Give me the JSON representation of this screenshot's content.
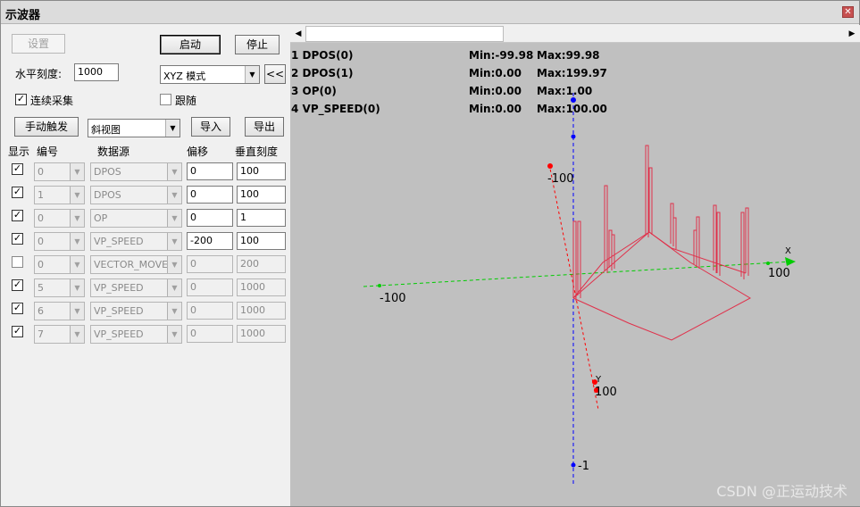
{
  "window": {
    "title": "示波器"
  },
  "controls": {
    "settings_label": "设置",
    "start_label": "启动",
    "stop_label": "停止",
    "hscale_label": "水平刻度:",
    "hscale_value": "1000",
    "mode_value": "XYZ 模式",
    "collapse_label": "<<",
    "continuous_label": "连续采集",
    "follow_label": "跟随",
    "manual_trigger_label": "手动触发",
    "view_value": "斜视图",
    "import_label": "导入",
    "export_label": "导出"
  },
  "channels": {
    "headers": [
      "显示",
      "编号",
      "数据源",
      "偏移",
      "垂直刻度"
    ],
    "rows": [
      {
        "show": true,
        "id": "0",
        "source": "DPOS",
        "offset": "0",
        "scale": "100",
        "enabled": true
      },
      {
        "show": true,
        "id": "1",
        "source": "DPOS",
        "offset": "0",
        "scale": "100",
        "enabled": true
      },
      {
        "show": true,
        "id": "0",
        "source": "OP",
        "offset": "0",
        "scale": "1",
        "enabled": true
      },
      {
        "show": true,
        "id": "0",
        "source": "VP_SPEED",
        "offset": "-200",
        "scale": "100",
        "enabled": true
      },
      {
        "show": false,
        "id": "0",
        "source": "VECTOR_MOVED",
        "offset": "0",
        "scale": "200",
        "enabled": false
      },
      {
        "show": true,
        "id": "5",
        "source": "VP_SPEED",
        "offset": "0",
        "scale": "1000",
        "enabled": false
      },
      {
        "show": true,
        "id": "6",
        "source": "VP_SPEED",
        "offset": "0",
        "scale": "1000",
        "enabled": false
      },
      {
        "show": true,
        "id": "7",
        "source": "VP_SPEED",
        "offset": "0",
        "scale": "1000",
        "enabled": false
      }
    ]
  },
  "legend": [
    {
      "name": "1 DPOS(0)",
      "min": "Min:-99.98",
      "max": "Max:99.98"
    },
    {
      "name": "2 DPOS(1)",
      "min": "Min:0.00",
      "max": "Max:199.97"
    },
    {
      "name": "3 OP(0)",
      "min": "Min:0.00",
      "max": "Max:1.00"
    },
    {
      "name": "4 VP_SPEED(0)",
      "min": "Min:0.00",
      "max": "Max:100.00"
    }
  ],
  "axes": {
    "x_neg": "-100",
    "x_pos": "100",
    "x_name": "X",
    "y_neg": "-100",
    "y_pos": "100",
    "y_name": "Y",
    "z_neg": "-1"
  },
  "colors": {
    "x_axis": "#00cc00",
    "y_axis": "#ff0000",
    "z_axis": "#0000ff",
    "trace": "#e0304a"
  },
  "watermark": "CSDN @正运动技术"
}
